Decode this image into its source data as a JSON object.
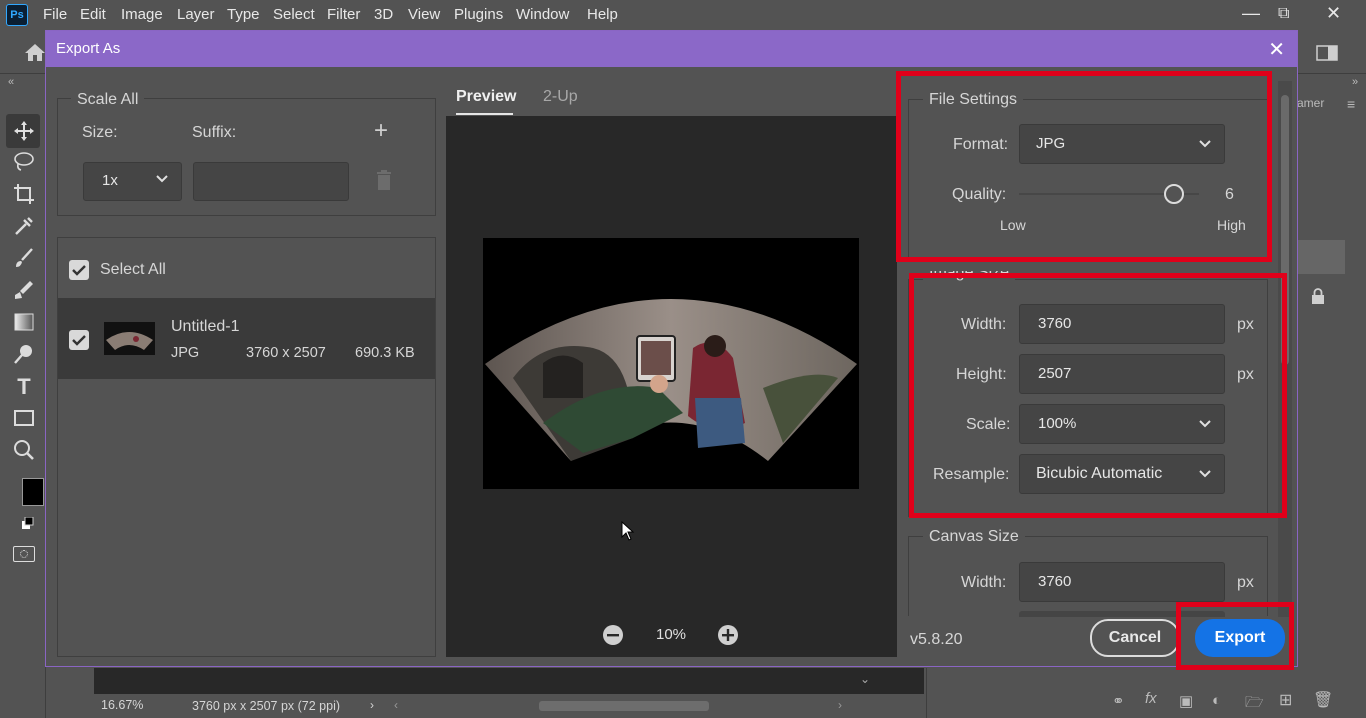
{
  "app": {
    "logo": "Ps",
    "menu": [
      "File",
      "Edit",
      "Image",
      "Layer",
      "Type",
      "Select",
      "Filter",
      "3D",
      "View",
      "Plugins",
      "Window",
      "Help"
    ]
  },
  "status": {
    "zoom": "16.67%",
    "doc_info": "3760 px x 2507 px (72 ppi)"
  },
  "right_panel": {
    "tab_partial": "amer"
  },
  "dialog": {
    "title": "Export As",
    "scale_all": {
      "title": "Scale All",
      "size_label": "Size:",
      "suffix_label": "Suffix:",
      "size_value": "1x",
      "suffix_value": ""
    },
    "assets": {
      "select_all_label": "Select All",
      "items": [
        {
          "name": "Untitled-1",
          "format": "JPG",
          "dimensions": "3760 x 2507",
          "size": "690.3 KB"
        }
      ]
    },
    "tabs": [
      "Preview",
      "2-Up"
    ],
    "active_tab": "Preview",
    "zoom": "10%",
    "file_settings": {
      "title": "File Settings",
      "format_label": "Format:",
      "format_value": "JPG",
      "quality_label": "Quality:",
      "quality_value": "6",
      "quality_fraction": 0.86,
      "low_label": "Low",
      "high_label": "High"
    },
    "image_size": {
      "title": "Image Size",
      "width_label": "Width:",
      "width_value": "3760",
      "height_label": "Height:",
      "height_value": "2507",
      "scale_label": "Scale:",
      "scale_value": "100%",
      "resample_label": "Resample:",
      "resample_value": "Bicubic Automatic",
      "unit": "px"
    },
    "canvas_size": {
      "title": "Canvas Size",
      "width_label": "Width:",
      "width_value": "3760",
      "unit": "px"
    },
    "version": "v5.8.20",
    "cancel_label": "Cancel",
    "export_label": "Export"
  },
  "colors": {
    "title_bar": "#8b68c8",
    "export_button": "#1473e6",
    "highlight": "#e0001a"
  }
}
